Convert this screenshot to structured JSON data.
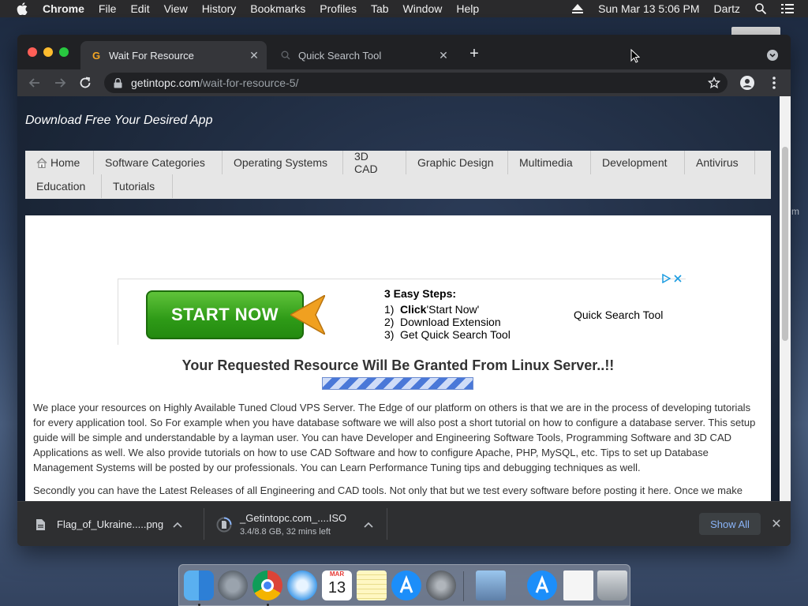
{
  "menubar": {
    "app": "Chrome",
    "items": [
      "File",
      "Edit",
      "View",
      "History",
      "Bookmarks",
      "Profiles",
      "Tab",
      "Window",
      "Help"
    ],
    "datetime": "Sun Mar 13  5:06 PM",
    "user": "Dartz"
  },
  "browser": {
    "tabs": [
      {
        "title": "Wait For Resource",
        "favicon": "G"
      },
      {
        "title": "Quick Search Tool"
      }
    ],
    "url_host": "getintopc.com",
    "url_path": "/wait-for-resource-5/"
  },
  "site": {
    "tagline": "Download Free Your Desired App",
    "nav": [
      "Home",
      "Software Categories",
      "Operating Systems",
      "3D CAD",
      "Graphic Design",
      "Multimedia",
      "Development",
      "Antivirus",
      "Education",
      "Tutorials"
    ]
  },
  "ad": {
    "button": "START NOW",
    "steps_title": "3 Easy Steps:",
    "steps": [
      {
        "num": "1)",
        "bold": "Click",
        "text": " 'Start Now'"
      },
      {
        "num": "2)",
        "bold": "",
        "text": "Download Extension"
      },
      {
        "num": "3)",
        "bold": "",
        "text": "Get Quick Search Tool"
      }
    ],
    "brand": "Quick Search Tool"
  },
  "page": {
    "resource_title": "Your Requested Resource Will Be Granted From Linux Server..!!",
    "paragraph1": "We place your resources on Highly Available Tuned Cloud VPS Server. The Edge of our platform on others is that we are in the process of developing tutorials for every application tool. So For example when you have database software we will also post a short tutorial on how to configure a database server. This setup guide will be simple and understandable by a layman user. You can have Developer and Engineering Software Tools, Programming Software and 3D CAD Applications as well. We also provide tutorials on how to use CAD Software and how to configure Apache, PHP, MySQL, etc. Tips to set up Database Management Systems will be posted by our professionals. You can Learn Performance Tuning tips and debugging techniques as well.",
    "paragraph2": "Secondly you can have the Latest Releases of all Engineering and CAD tools. Not only that but we test every software before posting it here. Once we make"
  },
  "downloads": {
    "items": [
      {
        "name": "Flag_of_Ukraine.....png",
        "status": ""
      },
      {
        "name": "_Getintopc.com_....ISO",
        "status": "3.4/8.8 GB, 32 mins left"
      }
    ],
    "show_all": "Show All"
  },
  "dock": {
    "calendar_month": "MAR",
    "calendar_day": "13"
  },
  "desktop": {
    "partial_label": "m"
  }
}
